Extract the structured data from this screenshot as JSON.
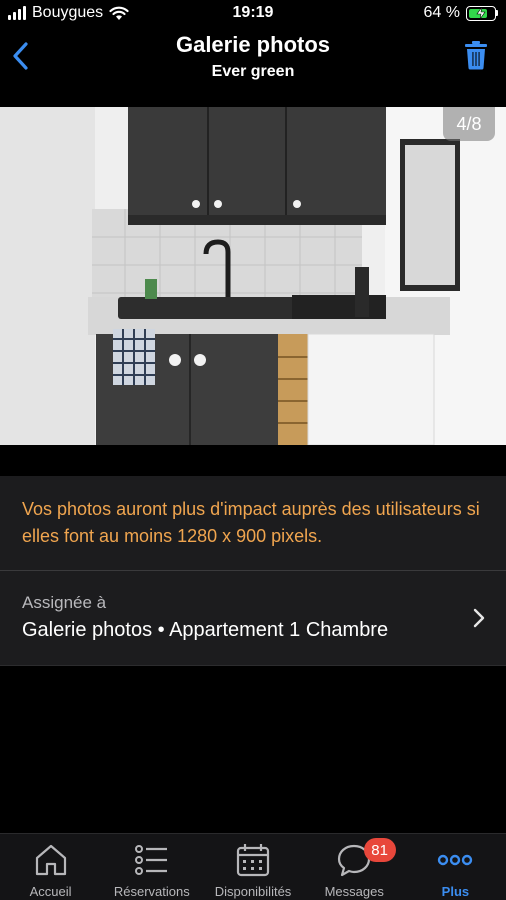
{
  "status_bar": {
    "carrier": "Bouygues",
    "time": "19:19",
    "battery": "64 %",
    "battery_level": 0.64
  },
  "header": {
    "title": "Galerie photos",
    "subtitle": "Ever green"
  },
  "gallery": {
    "counter": "4/8"
  },
  "notice": {
    "text": "Vos photos auront plus d'impact auprès des utilisateurs si elles font au moins 1280 x 900 pixels."
  },
  "assignment": {
    "label": "Assignée à",
    "value": "Galerie photos • Appartement 1 Chambre"
  },
  "tabbar": {
    "tabs": [
      {
        "label": "Accueil",
        "icon": "home-icon"
      },
      {
        "label": "Réservations",
        "icon": "list-icon"
      },
      {
        "label": "Disponibilités",
        "icon": "calendar-icon"
      },
      {
        "label": "Messages",
        "icon": "chat-bubble-icon",
        "badge": "81"
      },
      {
        "label": "Plus",
        "icon": "more-dots-icon",
        "active": true
      }
    ]
  },
  "colors": {
    "accent": "#3b8df0",
    "notice_text": "#f0a54f",
    "badge": "#e8473b",
    "card_bg": "#1c1c1e"
  }
}
